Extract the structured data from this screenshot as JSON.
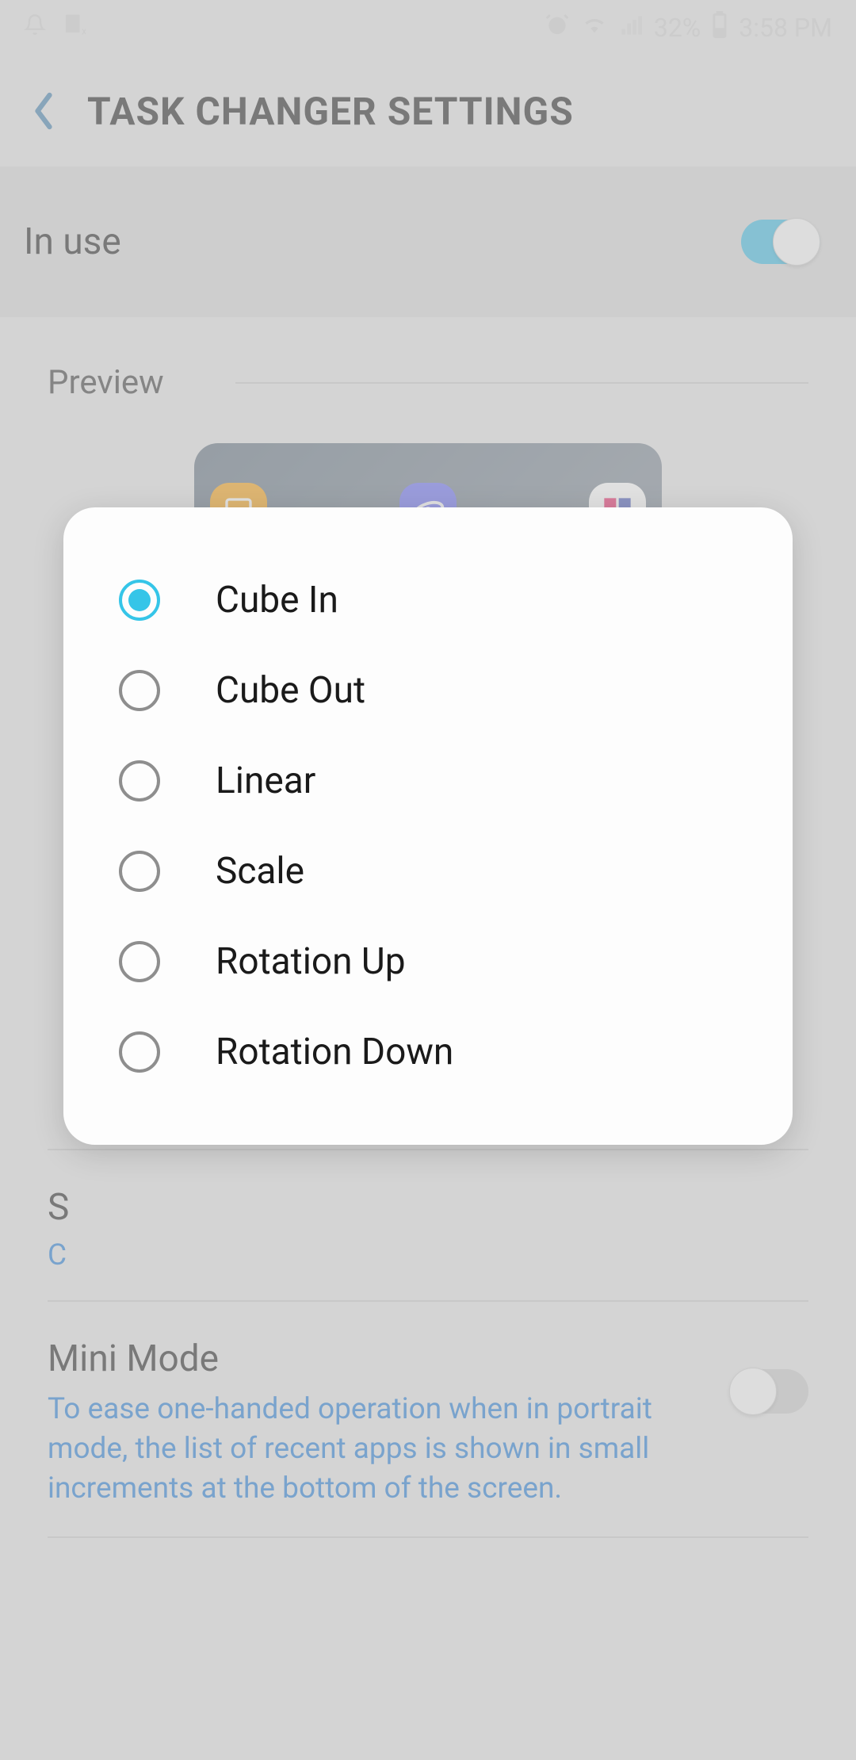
{
  "status": {
    "battery_percent": "32%",
    "time": "3:58 PM"
  },
  "header": {
    "title": "TASK CHANGER SETTINGS"
  },
  "in_use": {
    "label": "In use",
    "enabled": true
  },
  "preview": {
    "label": "Preview"
  },
  "style_setting": {
    "title_initial": "S",
    "value_initial": "C"
  },
  "mini_mode": {
    "title": "Mini Mode",
    "description": "To ease one-handed operation when in portrait mode, the list of recent apps is shown in small increments at the bottom of the screen.",
    "enabled": false
  },
  "dialog": {
    "options": [
      {
        "label": "Cube In",
        "selected": true
      },
      {
        "label": "Cube Out",
        "selected": false
      },
      {
        "label": "Linear",
        "selected": false
      },
      {
        "label": "Scale",
        "selected": false
      },
      {
        "label": "Rotation Up",
        "selected": false
      },
      {
        "label": "Rotation Down",
        "selected": false
      }
    ]
  }
}
